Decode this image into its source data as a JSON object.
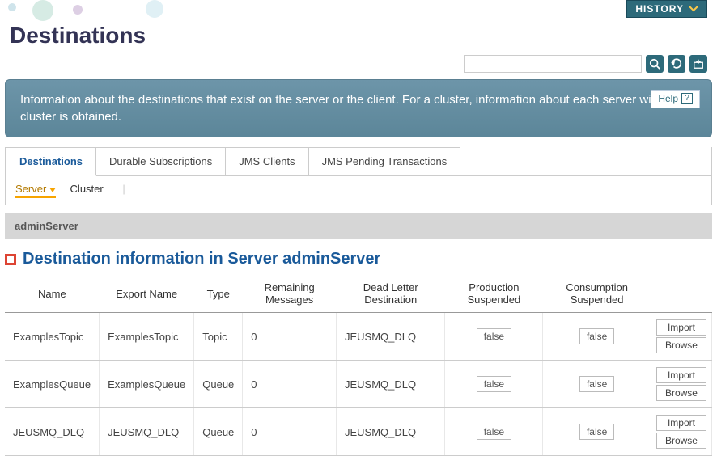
{
  "page_title": "Destinations",
  "history_label": "HISTORY",
  "search_placeholder": "",
  "info_text": "Information about the destinations that exist on the server or the client. For a cluster, information about each server within the cluster is obtained.",
  "help_label": "Help",
  "tabs": [
    {
      "label": "Destinations",
      "active": true
    },
    {
      "label": "Durable Subscriptions",
      "active": false
    },
    {
      "label": "JMS Clients",
      "active": false
    },
    {
      "label": "JMS Pending Transactions",
      "active": false
    }
  ],
  "subtabs": {
    "server": "Server",
    "cluster": "Cluster"
  },
  "server_name": "adminServer",
  "section_title": "Destination information in Server adminServer",
  "table": {
    "headers": {
      "name": "Name",
      "export_name": "Export Name",
      "type": "Type",
      "remaining": "Remaining Messages",
      "dld": "Dead Letter Destination",
      "prod_susp": "Production Suspended",
      "cons_susp": "Consumption Suspended"
    },
    "rows": [
      {
        "name": "ExamplesTopic",
        "export_name": "ExamplesTopic",
        "type": "Topic",
        "remaining": "0",
        "dld": "JEUSMQ_DLQ",
        "prod": "false",
        "cons": "false"
      },
      {
        "name": "ExamplesQueue",
        "export_name": "ExamplesQueue",
        "type": "Queue",
        "remaining": "0",
        "dld": "JEUSMQ_DLQ",
        "prod": "false",
        "cons": "false"
      },
      {
        "name": "JEUSMQ_DLQ",
        "export_name": "JEUSMQ_DLQ",
        "type": "Queue",
        "remaining": "0",
        "dld": "JEUSMQ_DLQ",
        "prod": "false",
        "cons": "false"
      }
    ],
    "actions": {
      "import": "Import",
      "browse": "Browse"
    }
  }
}
